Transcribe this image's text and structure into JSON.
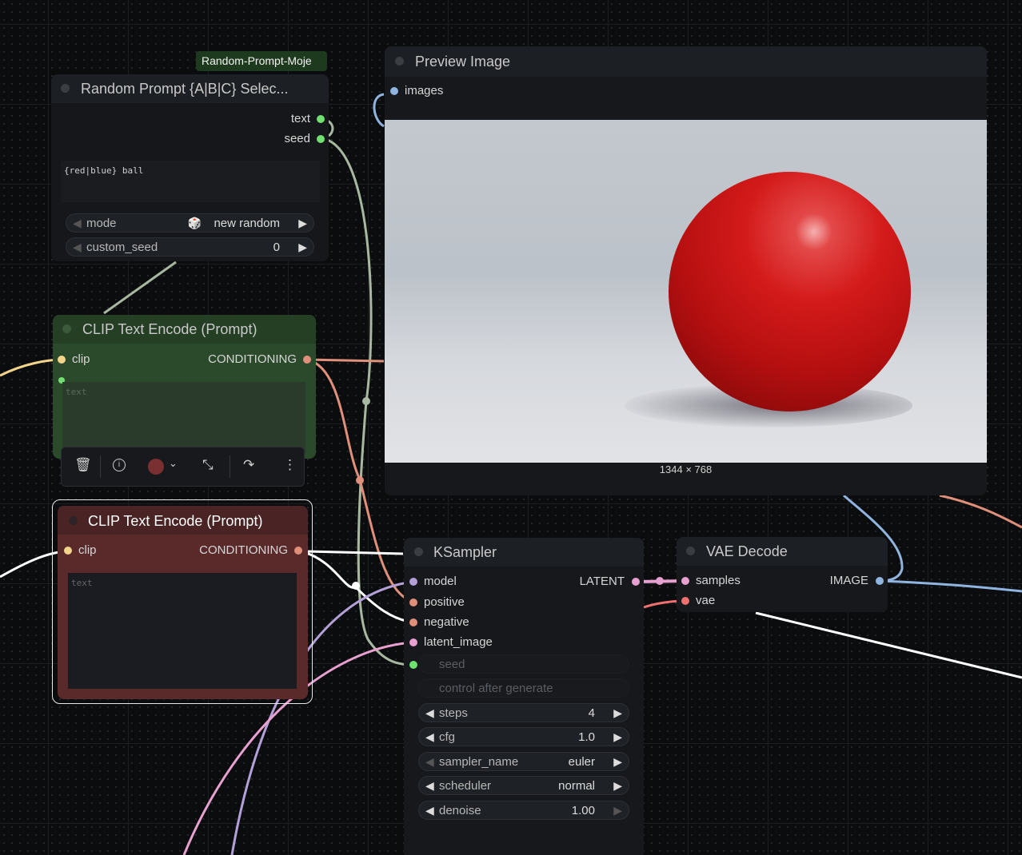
{
  "group_label": "Random-Prompt-Moje",
  "random_prompt": {
    "title": "Random Prompt {A|B|C} Selec...",
    "outputs": [
      "text",
      "seed"
    ],
    "prompt_text": "{red|blue} ball",
    "widgets": [
      {
        "label": "mode",
        "value": "new random",
        "icon": "dice-icon"
      },
      {
        "label": "custom_seed",
        "value": "0"
      }
    ]
  },
  "clip_green": {
    "title": "CLIP Text Encode (Prompt)",
    "input": "clip",
    "output": "CONDITIONING",
    "text_placeholder": "text"
  },
  "clip_red": {
    "title": "CLIP Text Encode (Prompt)",
    "input": "clip",
    "output": "CONDITIONING",
    "text_placeholder": "text"
  },
  "preview": {
    "title": "Preview Image",
    "input": "images",
    "dimensions": "1344 × 768"
  },
  "ksampler": {
    "title": "KSampler",
    "inputs": [
      "model",
      "positive",
      "negative",
      "latent_image"
    ],
    "output": "LATENT",
    "disabled_widgets": [
      "seed",
      "control after generate"
    ],
    "widgets": [
      {
        "label": "steps",
        "value": "4"
      },
      {
        "label": "cfg",
        "value": "1.0"
      },
      {
        "label": "sampler_name",
        "value": "euler"
      },
      {
        "label": "scheduler",
        "value": "normal"
      },
      {
        "label": "denoise",
        "value": "1.00"
      }
    ]
  },
  "vae_decode": {
    "title": "VAE Decode",
    "inputs": [
      "samples",
      "vae"
    ],
    "output": "IMAGE"
  },
  "toolbar": {
    "buttons": [
      "trash-icon",
      "info-icon",
      "color-icon",
      "collapse-icon",
      "bypass-icon",
      "more-icon"
    ],
    "color": "#7a3030"
  },
  "colors": {
    "clip": "#f2d48a",
    "conditioning": "#e0907a",
    "model": "#b4a0d8",
    "latent": "#e8a0d0",
    "image": "#90b4e0",
    "vae": "#f07070",
    "string": "#70e070",
    "green_node": "#2b4a2b",
    "red_node": "#5a2a2a"
  }
}
